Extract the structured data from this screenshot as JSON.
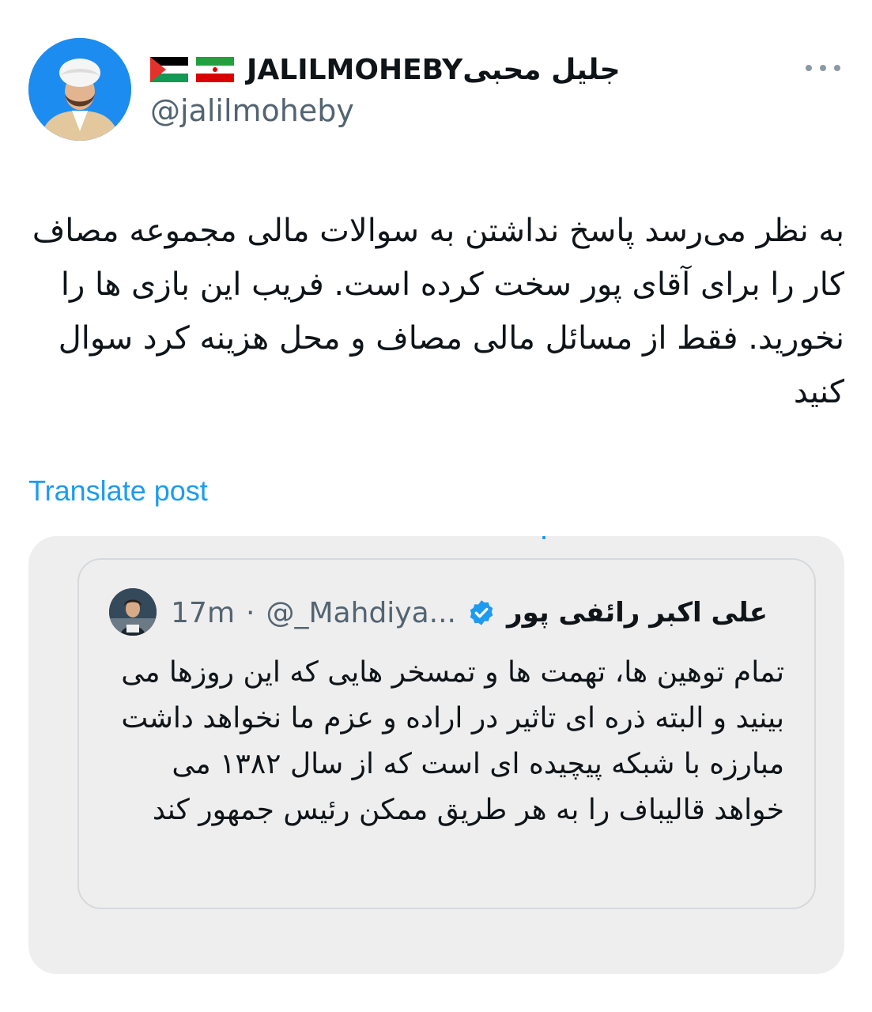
{
  "author": {
    "display_name": "JALILMOHEBYجلیل محبی",
    "handle": "@jalilmoheby",
    "flags": [
      "palestine-flag-icon",
      "iran-flag-icon"
    ],
    "avatar_icon": "profile-avatar"
  },
  "more_icon": "more-horizontal-icon",
  "tweet": {
    "text": "به نظر می‌رسد پاسخ نداشتن به سوالات مالی مجموعه مصاف کار را برای آقای پور سخت کرده است. فریب این بازی ها را نخورید. فقط از مسائل مالی مصاف و محل هزینه کرد سوال کنید"
  },
  "translate_label": "Translate post",
  "quote": {
    "name": "علی اکبر رائفی پور",
    "verified_icon": "verified-badge-icon",
    "handle": "@_Mahdiya...",
    "separator": "·",
    "time": "17m",
    "text": "تمام توهین ها، تهمت ها و تمسخر هایی که این روزها می بینید و البته ذره ای تاثیر در اراده و عزم ما نخواهد داشت مبارزه با شبکه پیچیده ای است که از سال ۱۳۸۲ می خواهد قالیباف را به هر طریق ممکن رئیس جمهور کند"
  },
  "colors": {
    "text": "#0f1419",
    "secondary": "#536471",
    "link": "#1d9bf0",
    "avatar_bg": "#1d8cf0",
    "quote_bg": "#eeeeee"
  }
}
